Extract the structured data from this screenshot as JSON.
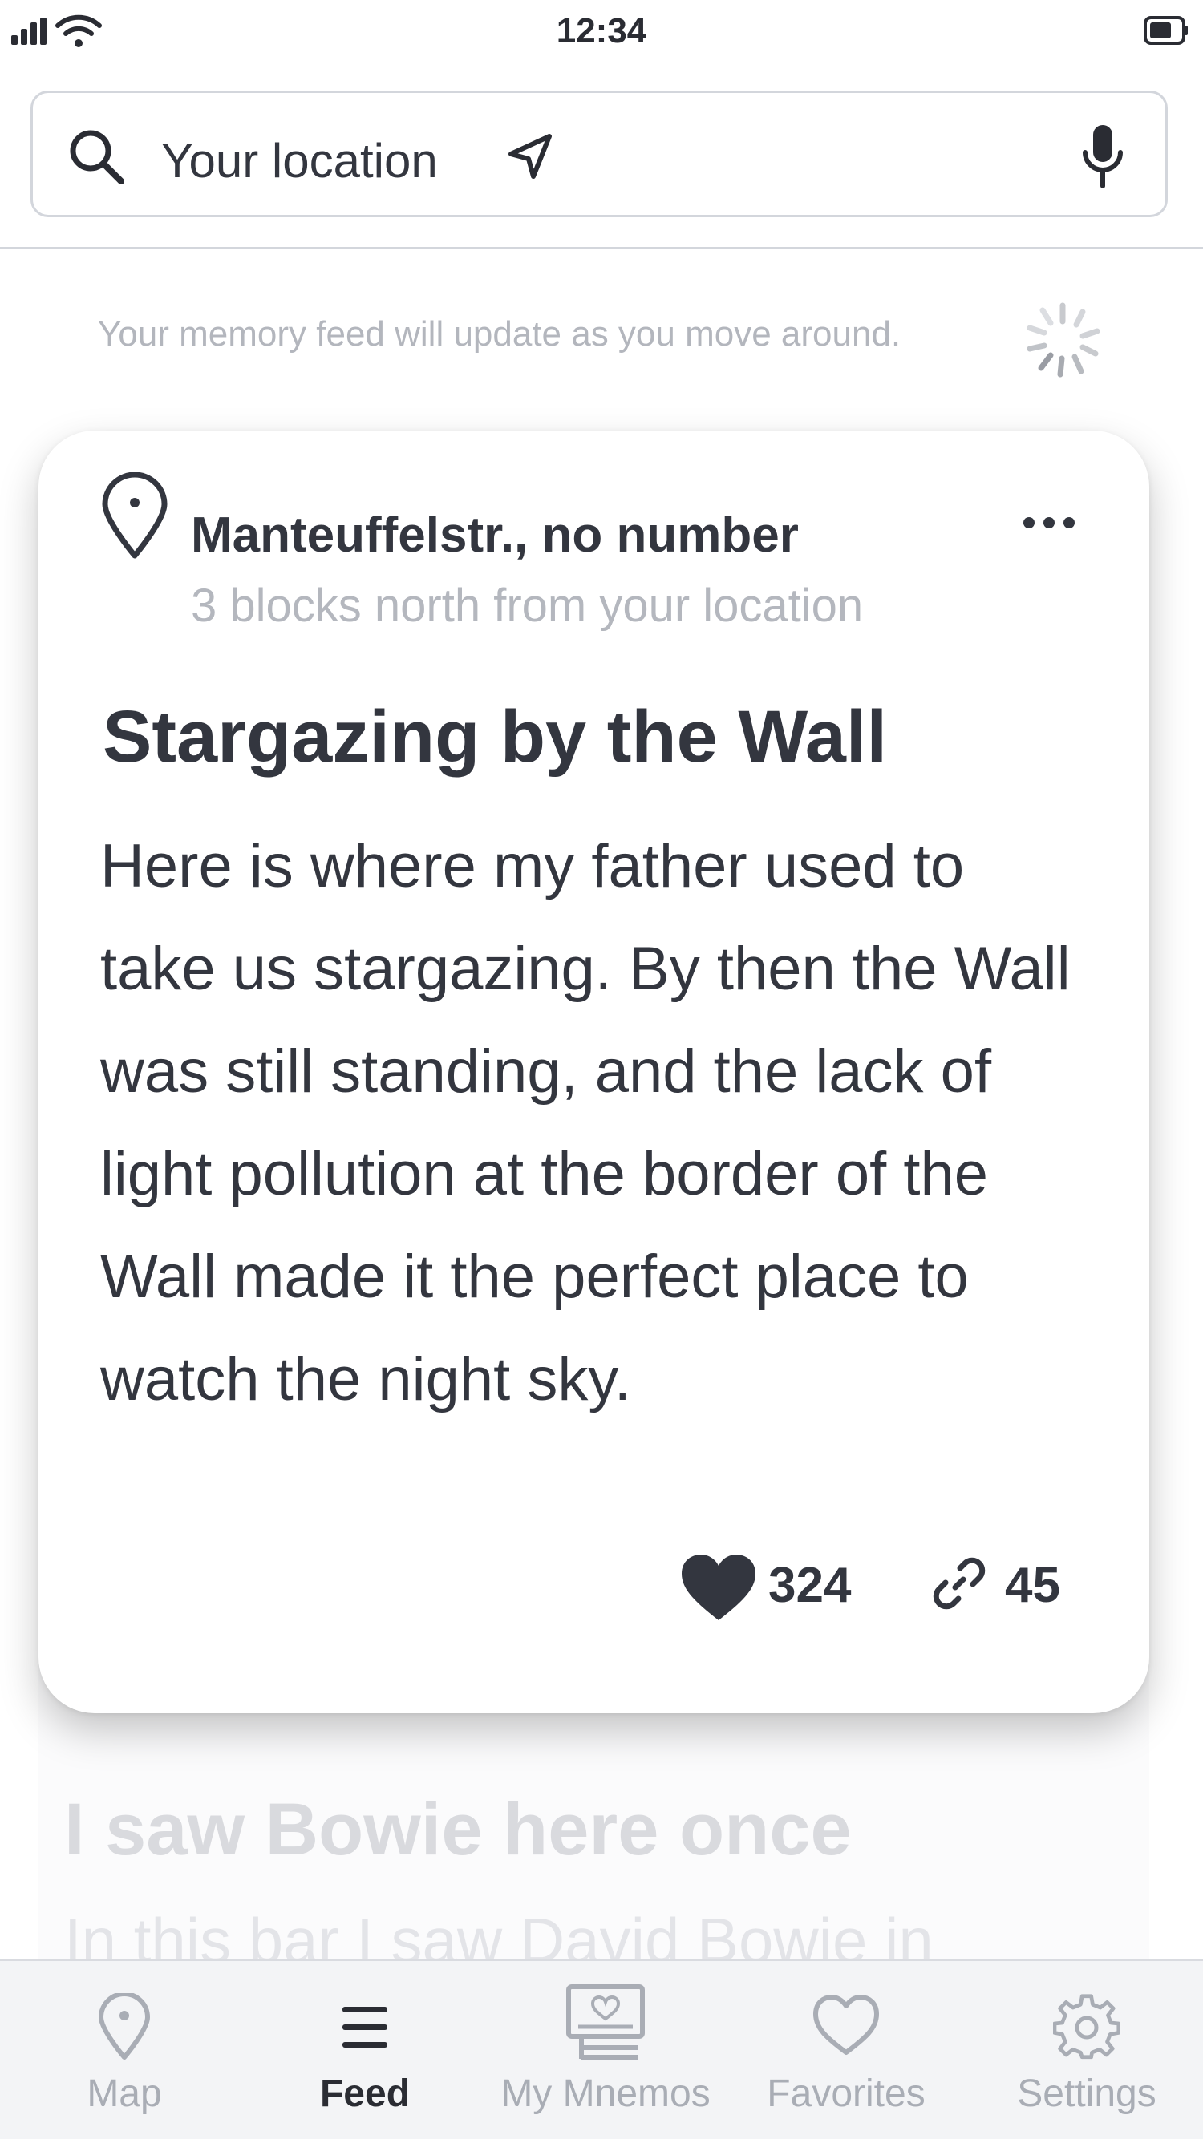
{
  "status_bar": {
    "time": "12:34"
  },
  "search": {
    "text": "Your location"
  },
  "feed": {
    "notice": "Your memory feed will update as you move around."
  },
  "card": {
    "address": "Manteuffelstr., no number",
    "distance": "3 blocks north from your location",
    "title": "Stargazing by the Wall",
    "body": "Here is where my father used to take us stargazing. By then the Wall was still standing, and the lack of light pollution at the border of the Wall made it the perfect place to watch the night sky.",
    "likes": "324",
    "links": "45"
  },
  "next_card": {
    "title": "I saw Bowie here once",
    "body_partial": "In this bar I saw David Bowie in"
  },
  "tabs": [
    {
      "label": "Map",
      "icon": "map-pin-icon",
      "active": false
    },
    {
      "label": "Feed",
      "icon": "hamburger-menu-icon",
      "active": true
    },
    {
      "label": "My Mnemos",
      "icon": "mnemo-card-icon",
      "active": false
    },
    {
      "label": "Favorites",
      "icon": "heart-outline-icon",
      "active": false
    },
    {
      "label": "Settings",
      "icon": "gear-icon",
      "active": false
    }
  ],
  "colors": {
    "text": "#33363f",
    "muted": "#b4b7be",
    "tab_inactive": "#a9adb5",
    "tab_bg": "#f3f4f6"
  }
}
